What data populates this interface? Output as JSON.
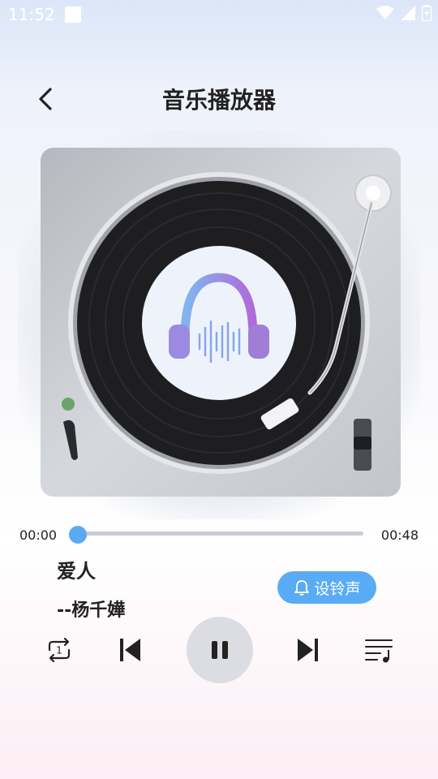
{
  "status_bar": {
    "time": "11:52"
  },
  "header": {
    "title": "音乐播放器",
    "back_icon": "chevron-left-icon"
  },
  "player": {
    "current_time": "00:00",
    "total_time": "00:48",
    "progress": 0.0,
    "song_title": "爱人",
    "artist": "--杨千嬅",
    "ringtone_label": "设铃声",
    "ringtone_icon": "bell-icon",
    "accent_color": "#5aabf5"
  },
  "controls": {
    "repeat_icon": "repeat-one-icon",
    "prev_icon": "skip-previous-icon",
    "play_icon": "pause-icon",
    "next_icon": "skip-next-icon",
    "list_icon": "playlist-icon"
  }
}
